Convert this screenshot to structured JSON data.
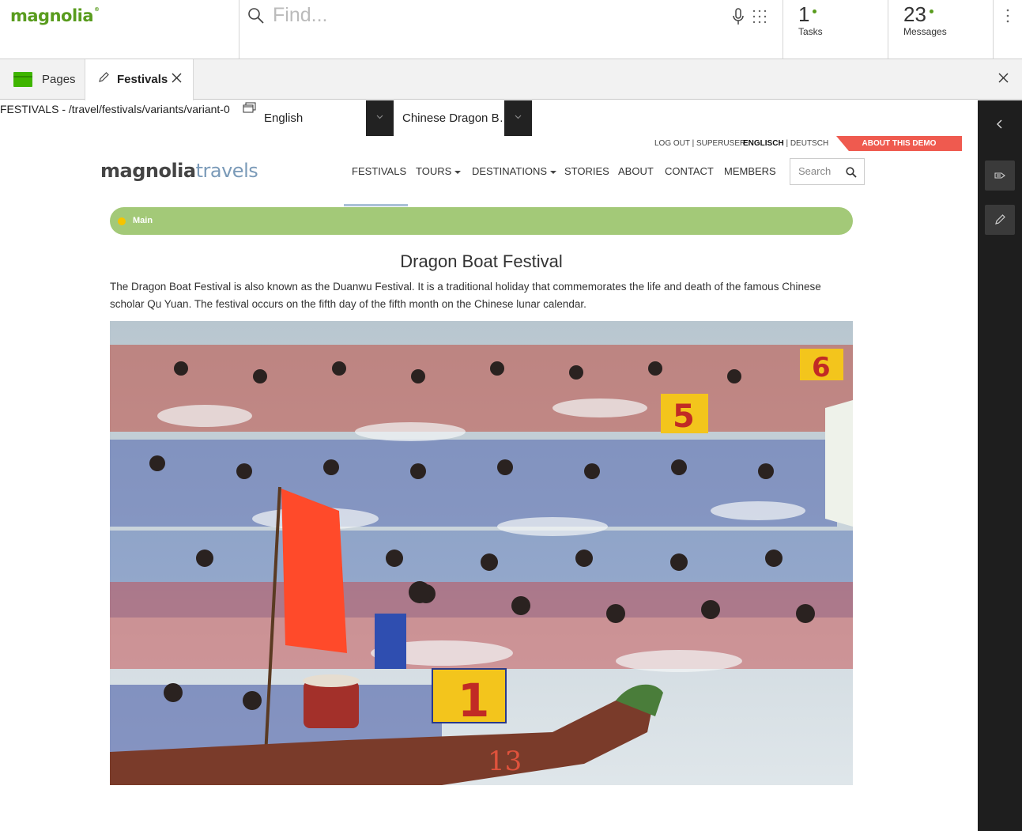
{
  "app": {
    "logo": "magnolia",
    "search_placeholder": "Find...",
    "tasks": {
      "count": "1",
      "label": "Tasks"
    },
    "messages": {
      "count": "23",
      "label": "Messages"
    }
  },
  "tabs": {
    "pages_label": "Pages",
    "active_label": "Festivals"
  },
  "editor": {
    "path": "FESTIVALS - /travel/festivals/variants/variant-0",
    "language": "English",
    "variant": "Chinese Dragon B…"
  },
  "site": {
    "util_left": "LOG OUT | SUPERUSER",
    "util_lang_active": "ENGLISCH",
    "util_lang_other": " | DEUTSCH",
    "about_demo": "ABOUT THIS DEMO",
    "brand_part1": "magnolia",
    "brand_part2": "travels",
    "nav": {
      "festivals": "FESTIVALS",
      "tours": "TOURS",
      "destinations": "DESTINATIONS",
      "stories": "STORIES",
      "about": "ABOUT",
      "contact": "CONTACT",
      "members": "MEMBERS"
    },
    "search_placeholder": "Search",
    "area_label": "Main",
    "title": "Dragon Boat Festival",
    "intro": "The Dragon Boat Festival is also known as the Duanwu Festival. It is a traditional holiday that commemorates the life and death of the famous Chinese scholar Qu Yuan. The festival occurs on the fifth day of the fifth month on the Chinese lunar calendar.",
    "photo": {
      "sign_1": "1",
      "sign_5": "5",
      "sign_6": "6",
      "hull_number": "13"
    }
  },
  "colors": {
    "brand_green": "#599c1e",
    "area_green": "#a3c978",
    "demo_red": "#ef5a4f",
    "panel_dark": "#1e1e1e"
  }
}
